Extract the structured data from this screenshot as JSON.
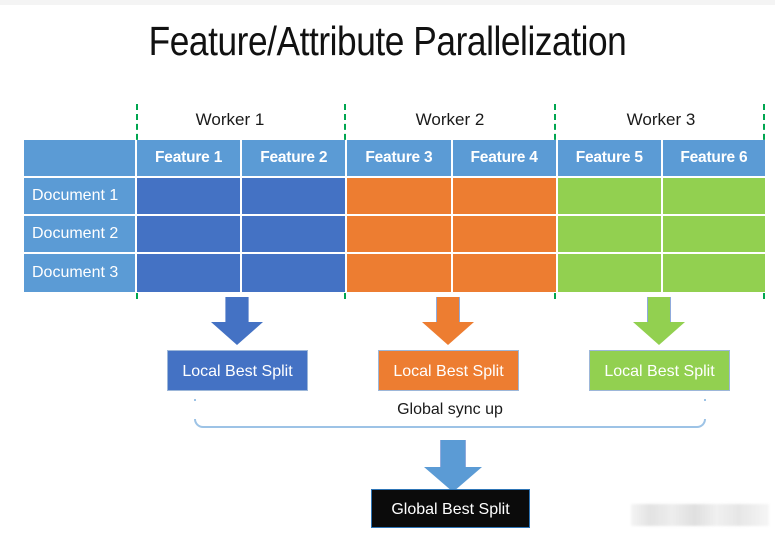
{
  "slide": {
    "title": "Feature/Attribute Parallelization",
    "background_color": "#ffffff"
  },
  "colors": {
    "header_blue": "#5B9BD5",
    "worker1_blue": "#4472C4",
    "worker2_orange": "#ED7D31",
    "worker3_green": "#92D050",
    "divider_green": "#00A650",
    "bracket_blue": "#9DC3E6",
    "global_box_black": "#0b0b0b"
  },
  "workers": [
    {
      "label": "Worker 1",
      "color": "#4472C4",
      "local_box": "Local Best Split"
    },
    {
      "label": "Worker 2",
      "color": "#ED7D31",
      "local_box": "Local Best Split"
    },
    {
      "label": "Worker 3",
      "color": "#92D050",
      "local_box": "Local Best Split"
    }
  ],
  "table": {
    "corner_label": "",
    "feature_headers": [
      "Feature 1",
      "Feature 2",
      "Feature 3",
      "Feature 4",
      "Feature 5",
      "Feature 6"
    ],
    "row_labels": [
      "Document 1",
      "Document 2",
      "Document 3"
    ]
  },
  "flow": {
    "sync_label": "Global sync up",
    "global_box": "Global Best Split"
  },
  "watermark": {
    "text": ""
  }
}
